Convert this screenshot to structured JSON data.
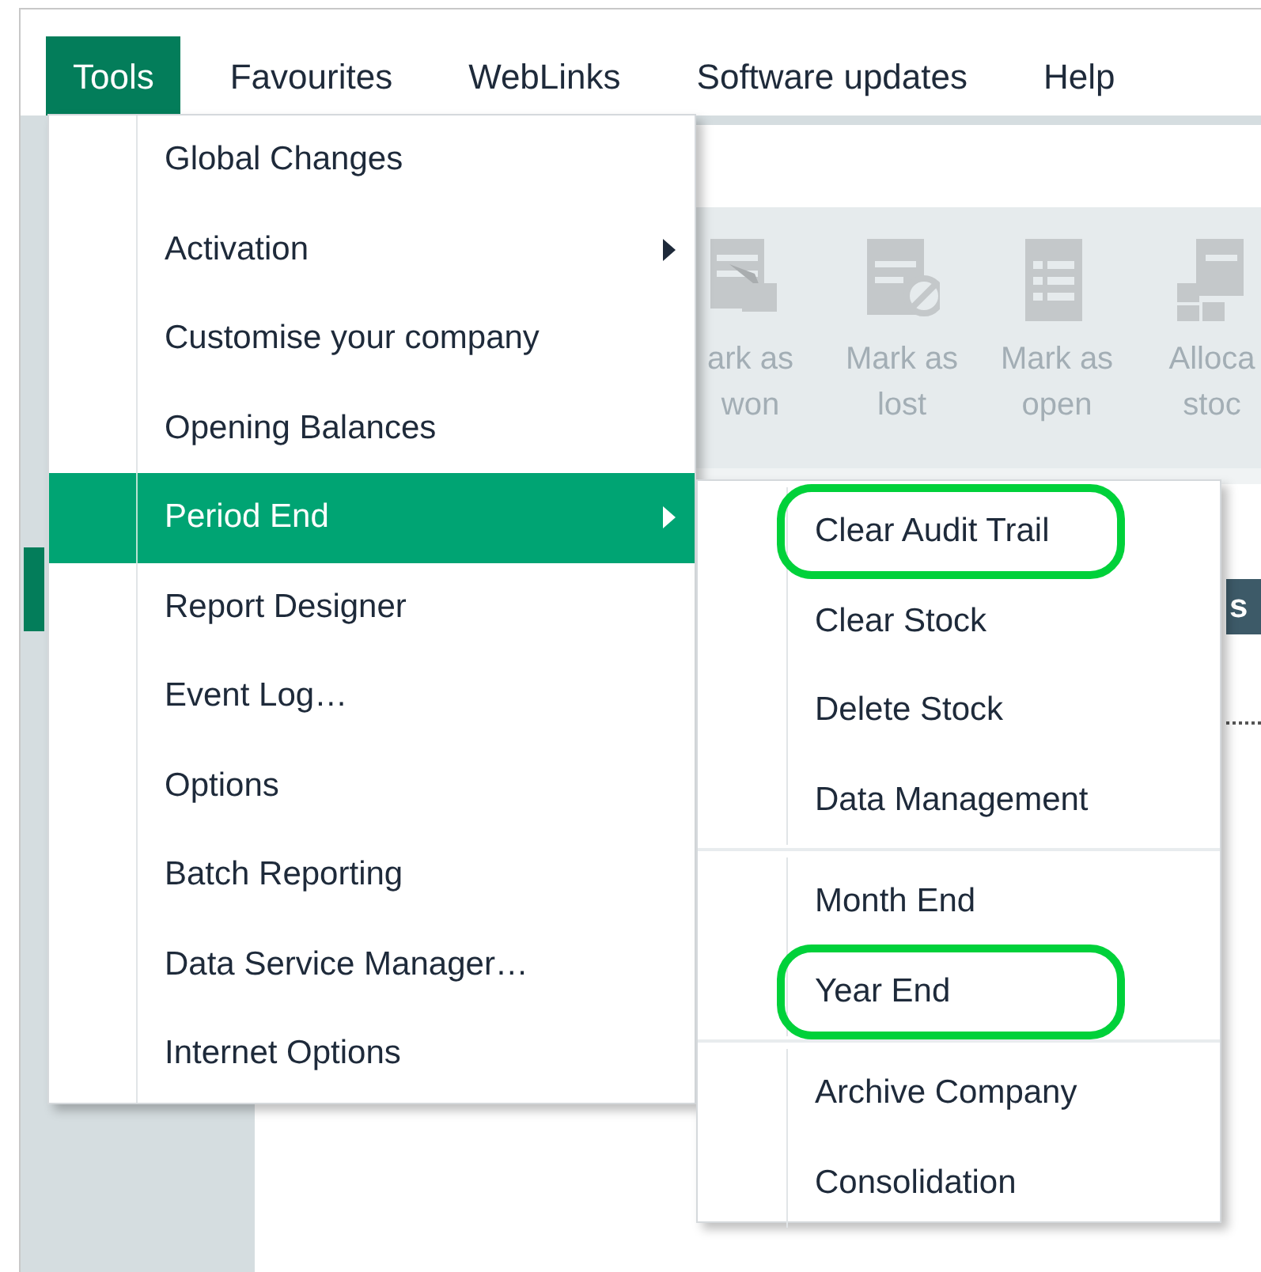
{
  "menu_bar": [
    {
      "label": "Tools",
      "selected": true
    },
    {
      "label": "Favourites",
      "selected": false
    },
    {
      "label": "WebLinks",
      "selected": false
    },
    {
      "label": "Software updates",
      "selected": false
    },
    {
      "label": "Help",
      "selected": false
    }
  ],
  "toolbar": {
    "buttons": [
      {
        "lines": [
          "ark as",
          "won"
        ],
        "disabled": true
      },
      {
        "lines": [
          "Mark as",
          "lost"
        ],
        "disabled": true
      },
      {
        "lines": [
          "Mark as",
          "open"
        ],
        "disabled": true
      },
      {
        "lines": [
          "Alloca",
          "stoc"
        ],
        "disabled": true
      }
    ]
  },
  "table_header_fragment": "s",
  "tools_menu": {
    "items": [
      {
        "label": "Global Changes",
        "has_submenu": false,
        "selected": false
      },
      {
        "label": "Activation",
        "has_submenu": true,
        "selected": false
      },
      {
        "label": "Customise your company",
        "has_submenu": false,
        "selected": false
      },
      {
        "label": "Opening Balances",
        "has_submenu": false,
        "selected": false
      },
      {
        "label": "Period End",
        "has_submenu": true,
        "selected": true
      },
      {
        "label": "Report Designer",
        "has_submenu": false,
        "selected": false
      },
      {
        "label": "Event Log…",
        "has_submenu": false,
        "selected": false
      },
      {
        "label": "Options",
        "has_submenu": false,
        "selected": false
      },
      {
        "label": "Batch Reporting",
        "has_submenu": false,
        "selected": false
      },
      {
        "label": "Data Service Manager…",
        "has_submenu": false,
        "selected": false
      },
      {
        "label": "Internet Options",
        "has_submenu": false,
        "selected": false
      }
    ]
  },
  "period_end_submenu": {
    "groups": [
      [
        {
          "label": "Clear Audit Trail",
          "highlighted": true
        },
        {
          "label": "Clear Stock",
          "highlighted": false
        },
        {
          "label": "Delete Stock",
          "highlighted": false
        },
        {
          "label": "Data Management",
          "highlighted": false
        }
      ],
      [
        {
          "label": "Month End",
          "highlighted": false
        },
        {
          "label": "Year End",
          "highlighted": true
        }
      ],
      [
        {
          "label": "Archive Company",
          "highlighted": false
        },
        {
          "label": "Consolidation",
          "highlighted": false
        }
      ]
    ]
  }
}
